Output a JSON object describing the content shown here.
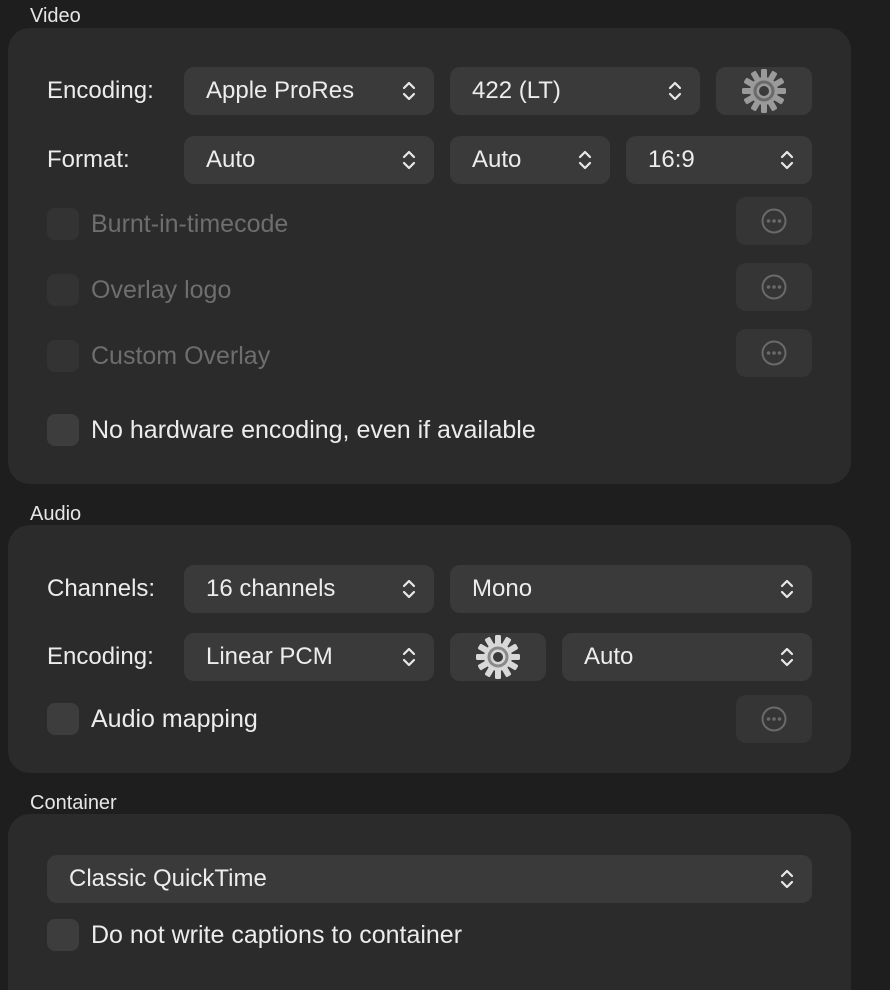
{
  "video": {
    "title": "Video",
    "encoding_label": "Encoding:",
    "codec": "Apple ProRes",
    "profile": "422 (LT)",
    "format_label": "Format:",
    "format": "Auto",
    "size": "Auto",
    "aspect": "16:9",
    "checks": [
      {
        "label": "Burnt-in-timecode",
        "enabled": false
      },
      {
        "label": "Overlay logo",
        "enabled": false
      },
      {
        "label": "Custom Overlay",
        "enabled": false
      },
      {
        "label": "No hardware encoding, even if available",
        "enabled": true
      }
    ]
  },
  "audio": {
    "title": "Audio",
    "channels_label": "Channels:",
    "channels": "16 channels",
    "layout": "Mono",
    "encoding_label": "Encoding:",
    "codec": "Linear PCM",
    "rate": "Auto",
    "mapping_label": "Audio mapping"
  },
  "container": {
    "title": "Container",
    "type": "Classic QuickTime",
    "captions_label": "Do not write captions to container"
  },
  "icons": {
    "gear": "gear-icon",
    "more": "ellipsis-circle-icon",
    "chevron": "chevron-up-down-icon"
  }
}
